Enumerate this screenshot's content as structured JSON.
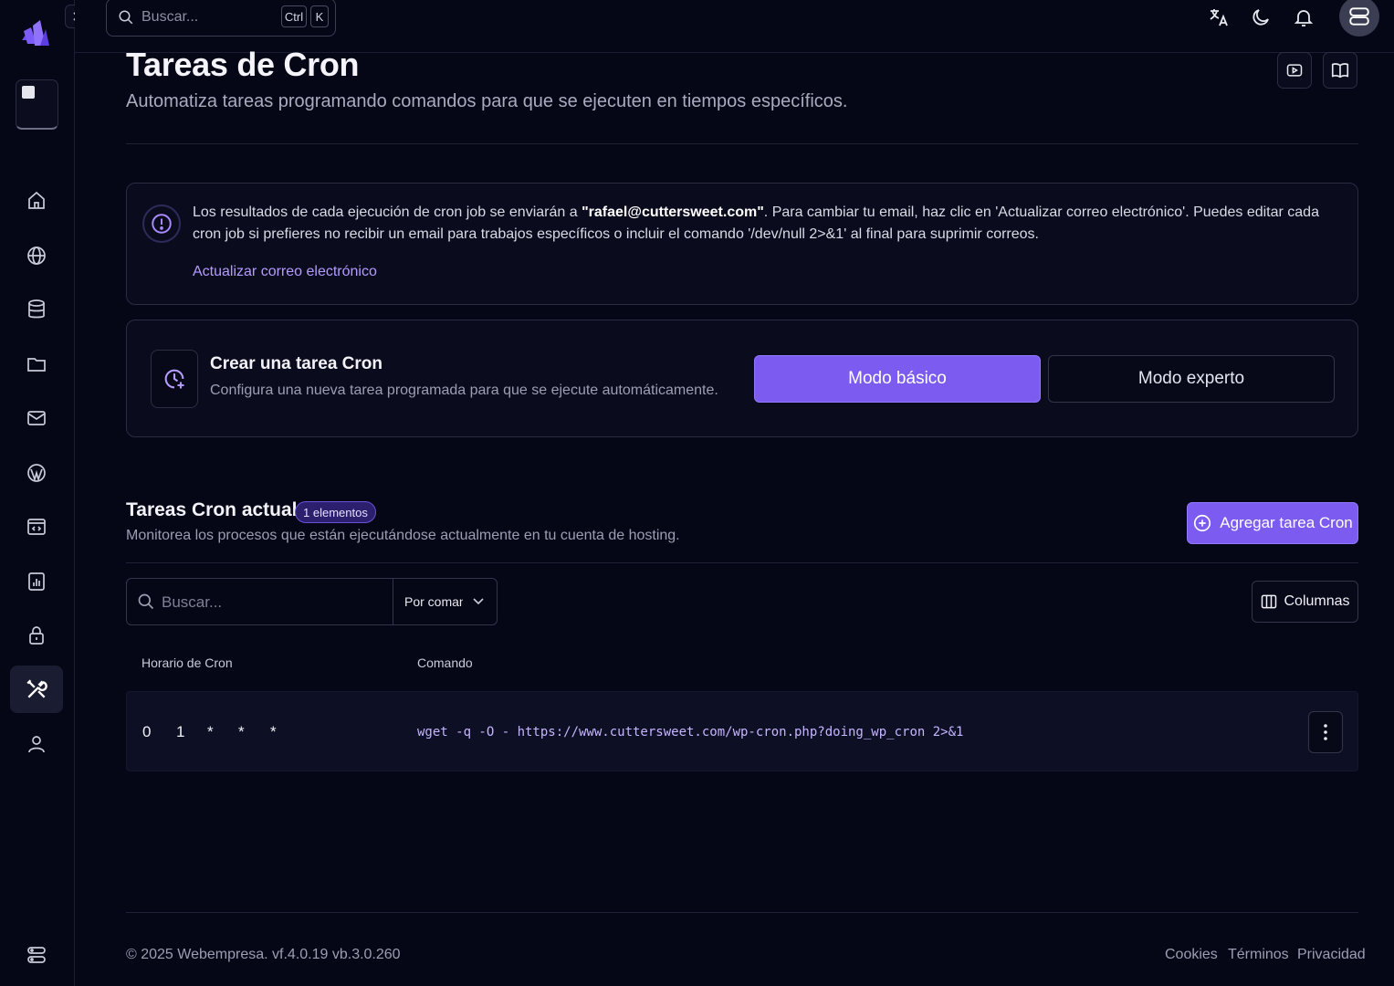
{
  "topbar": {
    "search_placeholder": "Buscar...",
    "shortcut_key1": "Ctrl",
    "shortcut_key2": "K"
  },
  "page": {
    "title": "Tareas de Cron",
    "subtitle": "Automatiza tareas programando comandos para que se ejecuten en tiempos específicos."
  },
  "info": {
    "text_before": "Los resultados de cada ejecución de cron job se enviarán a ",
    "email": "\"rafael@cuttersweet.com\"",
    "text_after": ". Para cambiar tu email, haz clic en 'Actualizar correo electrónico'. Puedes editar cada cron job si prefieres no recibir un email para trabajos específicos o incluir el comando '/dev/null 2>&1' al final para suprimir correos.",
    "link": "Actualizar correo electrónico"
  },
  "create": {
    "title": "Crear una tarea Cron",
    "subtitle": "Configura una nueva tarea programada para que se ejecute automáticamente.",
    "mode_basic": "Modo básico",
    "mode_expert": "Modo experto"
  },
  "list": {
    "title": "Tareas Cron actuales",
    "badge": "1 elementos",
    "subtitle": "Monitorea los procesos que están ejecutándose actualmente en tu cuenta de hosting.",
    "add_button": "Agregar tarea Cron",
    "search_placeholder": "Buscar...",
    "filter_value": "Por comando",
    "columns_button": "Columnas",
    "headers": [
      "Horario de Cron",
      "Comando"
    ],
    "rows": [
      {
        "schedule": [
          "0",
          "1",
          "*",
          "*",
          "*"
        ],
        "command": "wget -q -O - https://www.cuttersweet.com/wp-cron.php?doing_wp_cron 2>&1"
      }
    ]
  },
  "footer": {
    "copyright": "© 2025 Webempresa. vf.4.0.19 vb.3.0.260",
    "links": [
      "Cookies",
      "Términos",
      "Privacidad"
    ]
  },
  "colors": {
    "accent": "#7c5cf0",
    "background": "#050716",
    "card": "#0a0c1e"
  }
}
